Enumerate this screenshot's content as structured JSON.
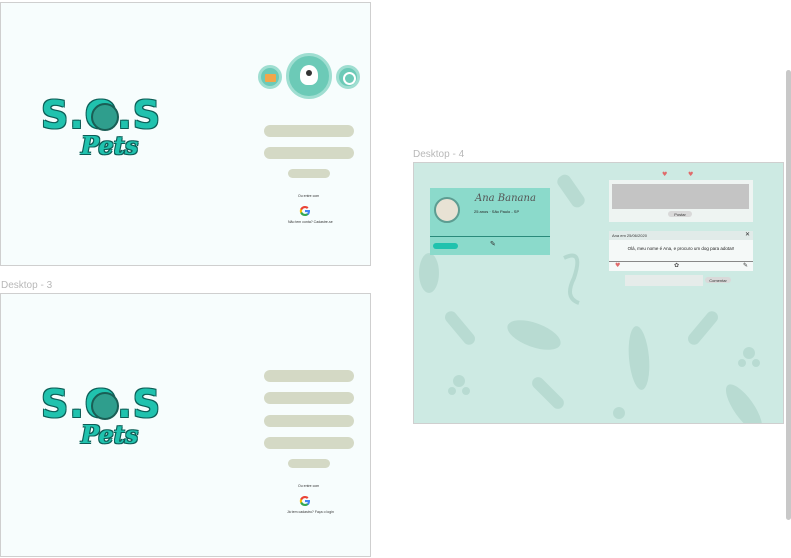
{
  "frames": {
    "desktop3_label": "Desktop - 3",
    "desktop4_label": "Desktop - 4"
  },
  "login": {
    "logo_sos": "S.O.S",
    "logo_pets": "Pets",
    "alt_login_caption": "Ou entre com",
    "signup_prompt": "Não tem conta? Cadastre-se"
  },
  "signup": {
    "logo_sos": "S.O.S",
    "logo_pets": "Pets",
    "alt_login_caption": "Ou entre com",
    "login_prompt": "Já tem cadastro? Faça o login"
  },
  "feed": {
    "profile": {
      "name": "Ana Banana",
      "details": "25 anos · São Paulo - SP"
    },
    "post_button": "Postar",
    "post": {
      "header": "Ana em 25/06/2020",
      "body": "Olá, meu nome é Ana, e procuro um dog para adotar!"
    },
    "comment_button": "Comentar"
  },
  "colors": {
    "accent": "#20c2ae",
    "feed_background": "#cdeae3",
    "input_bar": "#d4d9c5"
  },
  "icons": {
    "mail": "mail-icon",
    "dog": "dog-icon",
    "search": "search-icon",
    "google": "google-icon",
    "edit": "edit-icon",
    "heart": "heart-icon",
    "close": "close-icon"
  }
}
